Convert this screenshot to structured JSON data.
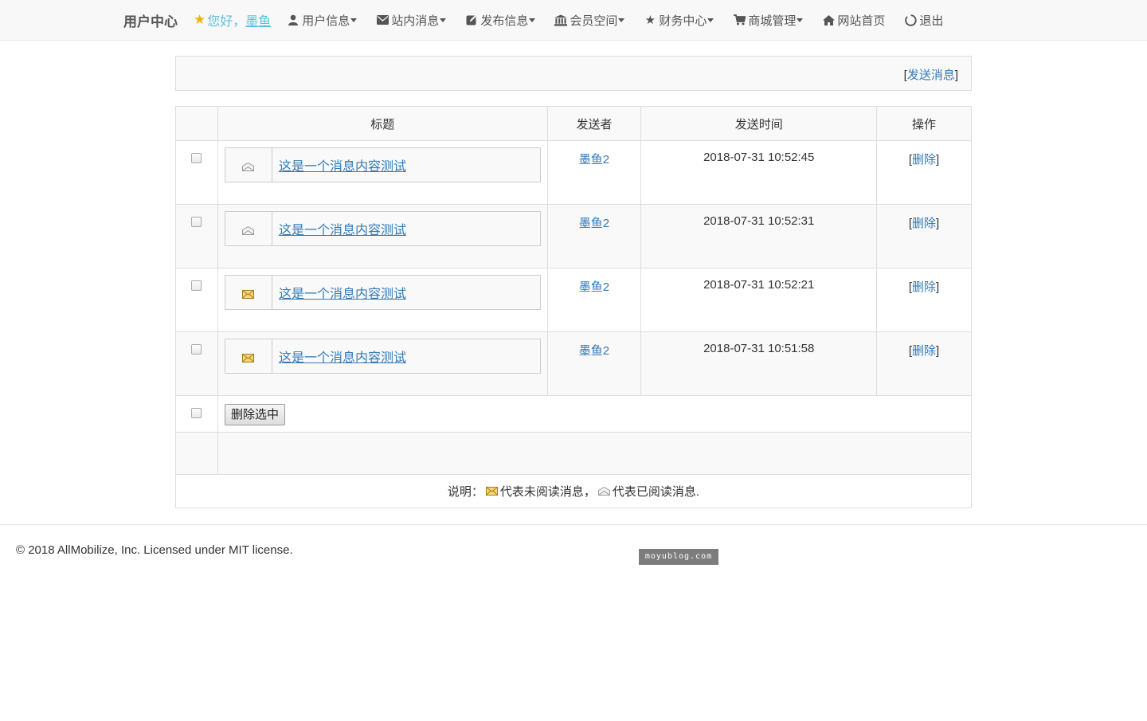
{
  "nav": {
    "brand": "用户中心",
    "greeting": "您好，",
    "username": "墨鱼",
    "items": [
      {
        "label": "用户信息",
        "icon": "user-icon",
        "caret": true
      },
      {
        "label": "站内消息",
        "icon": "envelope-icon",
        "caret": true
      },
      {
        "label": "发布信息",
        "icon": "edit-icon",
        "caret": true
      },
      {
        "label": "会员空间",
        "icon": "bank-icon",
        "caret": true
      },
      {
        "label": "财务中心",
        "icon": "star-icon",
        "caret": true
      },
      {
        "label": "商城管理",
        "icon": "cart-icon",
        "caret": true
      },
      {
        "label": "网站首页",
        "icon": "home-icon",
        "caret": false
      },
      {
        "label": "退出",
        "icon": "power-icon",
        "caret": false
      }
    ]
  },
  "send_bar": {
    "bracket_open": "[",
    "link": "发送消息",
    "bracket_close": "]"
  },
  "table": {
    "headers": [
      "",
      "标题",
      "发送者",
      "发送时间",
      "操作"
    ],
    "rows": [
      {
        "title": "这是一个消息内容测试",
        "sender": "墨鱼2",
        "time": "2018-07-31 10:52:45",
        "action": "删除",
        "status_icon": "read-envelope-icon"
      },
      {
        "title": "这是一个消息内容测试",
        "sender": "墨鱼2",
        "time": "2018-07-31 10:52:31",
        "action": "删除",
        "status_icon": "read-envelope-icon"
      },
      {
        "title": "这是一个消息内容测试",
        "sender": "墨鱼2",
        "time": "2018-07-31 10:52:21",
        "action": "删除",
        "status_icon": "unread-envelope-icon"
      },
      {
        "title": "这是一个消息内容测试",
        "sender": "墨鱼2",
        "time": "2018-07-31 10:51:58",
        "action": "删除",
        "status_icon": "unread-envelope-icon"
      }
    ],
    "delete_selected": "删除选中",
    "note": {
      "prefix": "说明：",
      "unread": "代表未阅读消息，",
      "read": "代表已阅读消息."
    }
  },
  "footer": {
    "copyright": "© 2018 AllMobilize, Inc. Licensed under MIT license."
  },
  "watermark": "moyublog.com",
  "colors": {
    "link": "#337ab7",
    "greeting": "#5bc0de",
    "star": "#f4b400"
  }
}
